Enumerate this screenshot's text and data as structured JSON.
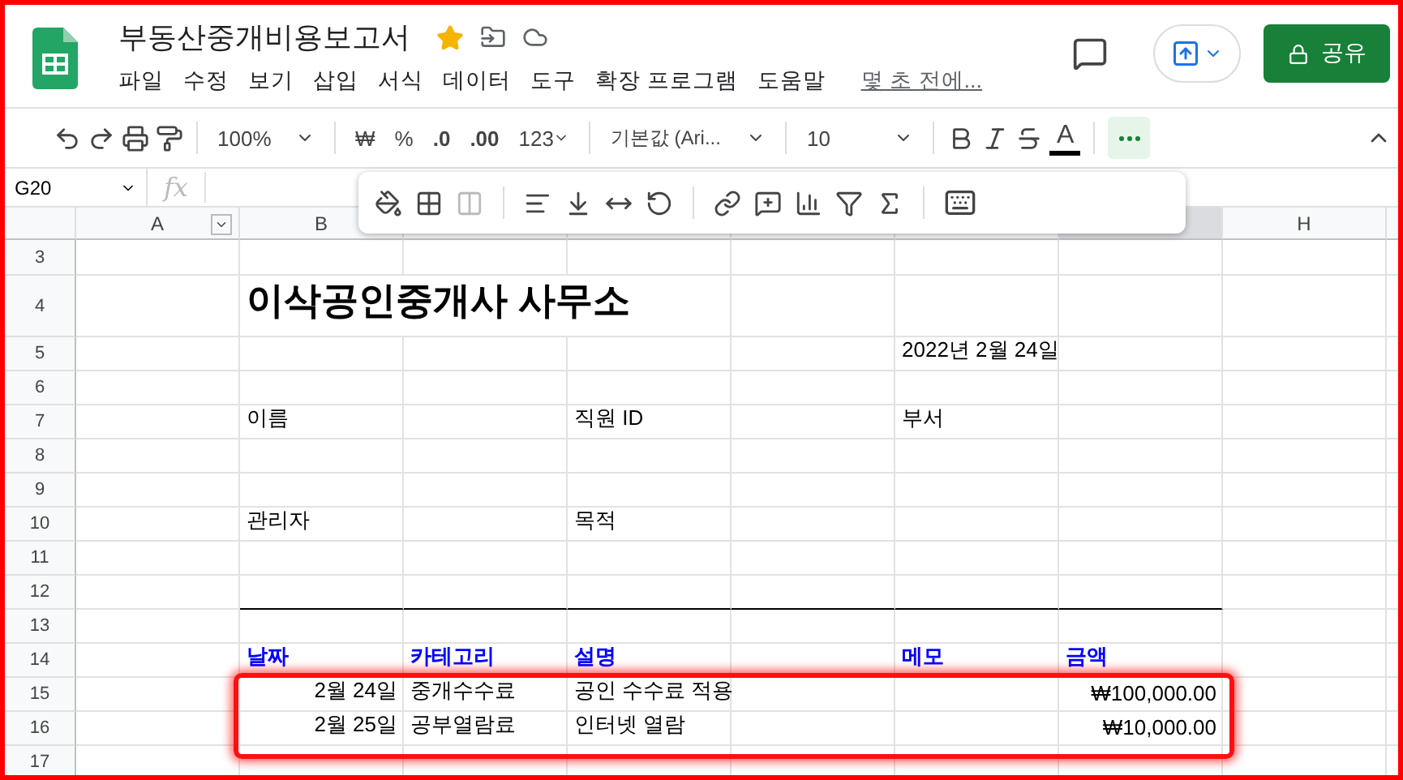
{
  "document": {
    "title": "부동산중개비용보고서",
    "starred": true,
    "menus": [
      "파일",
      "수정",
      "보기",
      "삽입",
      "서식",
      "데이터",
      "도구",
      "확장 프로그램",
      "도움말"
    ],
    "last_edit": "몇 초 전에..."
  },
  "share_button": "공유",
  "toolbar": {
    "zoom": "100%",
    "currency": "₩",
    "percent": "%",
    "decimal_less": ".0",
    "decimal_more": ".00",
    "number_format": "123",
    "font": "기본값 (Ari...",
    "font_size": "10",
    "text_color": "A"
  },
  "formula_bar": {
    "cell_ref": "G20",
    "fx": "fx"
  },
  "column_letters": [
    "A",
    "B",
    "H"
  ],
  "row_numbers": [
    "3",
    "4",
    "5",
    "6",
    "7",
    "8",
    "9",
    "10",
    "11",
    "12",
    "13",
    "14",
    "15",
    "16",
    "17"
  ],
  "sheet": {
    "title": "이삭공인중개사 사무소",
    "date": "2022년 2월 24일",
    "fields": [
      "이름",
      "직원 ID",
      "부서",
      "관리자",
      "목적"
    ],
    "table_headers": [
      "날짜",
      "카테고리",
      "설명",
      "메모",
      "금액"
    ],
    "entries": [
      {
        "date": "2월 24일",
        "category": "중개수수료",
        "description": "공인 수수료 적용",
        "amount": "₩100,000.00"
      },
      {
        "date": "2월 25일",
        "category": "공부열람료",
        "description": "인터넷 열람",
        "amount": "₩10,000.00"
      }
    ]
  }
}
